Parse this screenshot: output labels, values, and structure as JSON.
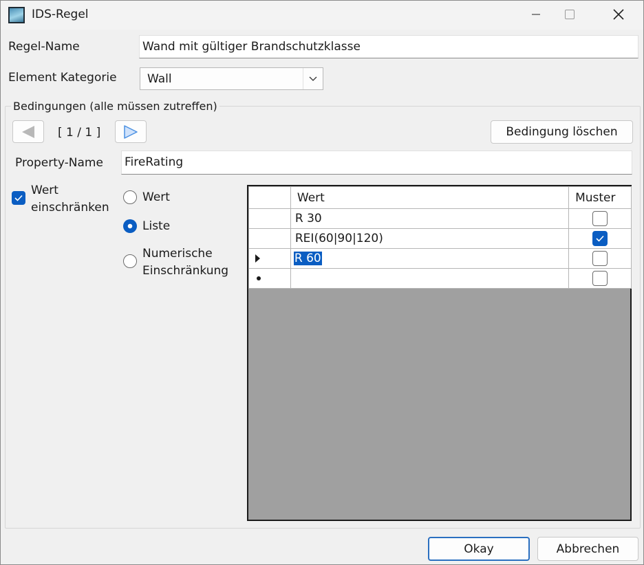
{
  "window": {
    "title": "IDS-Regel",
    "controls": {
      "minimize": "–",
      "maximize": "☐",
      "close": "✕"
    }
  },
  "form": {
    "rule_name_label": "Regel-Name",
    "rule_name_value": "Wand mit gültiger Brandschutzklasse",
    "element_category_label": "Element Kategorie",
    "element_category_value": "Wall"
  },
  "conditions": {
    "group_title": "Bedingungen (alle müssen zutreffen)",
    "pager": "[ 1 / 1 ]",
    "delete_button": "Bedingung löschen",
    "property_name_label": "Property-Name",
    "property_name_value": "FireRating",
    "restrict_value": {
      "line1": "Wert",
      "line2": "einschränken",
      "checked": true
    },
    "radios": [
      {
        "label": "Wert",
        "checked": false
      },
      {
        "label": "Liste",
        "checked": true
      },
      {
        "label_line1": "Numerische",
        "label_line2": "Einschränkung",
        "checked": false
      }
    ],
    "grid": {
      "headers": [
        "Wert",
        "Muster"
      ],
      "rows": [
        {
          "value": "R 30",
          "pattern": false
        },
        {
          "value": "REI(60|90|120)",
          "pattern": true
        },
        {
          "value": "R 60",
          "pattern": false,
          "current": true
        },
        {
          "value": "",
          "pattern": false,
          "new_row": true
        }
      ]
    }
  },
  "footer": {
    "ok_button": "Okay",
    "cancel_button": "Abbrechen"
  },
  "colors": {
    "accent": "#0a5dc2",
    "nav_next": "#4a90e2",
    "nav_prev_disabled": "#b8b8b8",
    "grid_background": "#a0a0a0"
  }
}
